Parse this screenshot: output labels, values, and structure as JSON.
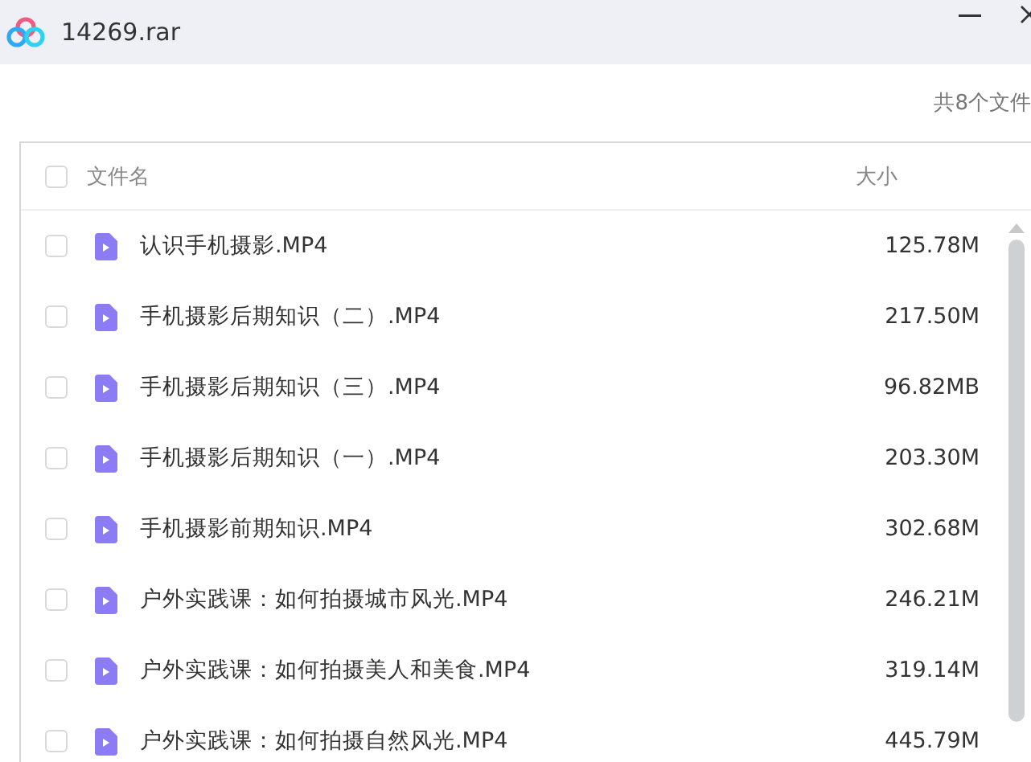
{
  "window": {
    "title": "14269.rar"
  },
  "summary": "共8个文件",
  "table": {
    "columns": [
      "文件名",
      "大小"
    ],
    "header_checked": false,
    "rows": [
      {
        "name": "认识手机摄影.MP4",
        "size": "125.78M",
        "checked": false
      },
      {
        "name": "手机摄影后期知识（二）.MP4",
        "size": "217.50M",
        "checked": false
      },
      {
        "name": "手机摄影后期知识（三）.MP4",
        "size": "96.82MB",
        "checked": false
      },
      {
        "name": "手机摄影后期知识（一）.MP4",
        "size": "203.30M",
        "checked": false
      },
      {
        "name": "手机摄影前期知识.MP4",
        "size": "302.68M",
        "checked": false
      },
      {
        "name": "户外实践课：如何拍摄城市风光.MP4",
        "size": "246.21M",
        "checked": false
      },
      {
        "name": "户外实践课：如何拍摄美人和美食.MP4",
        "size": "319.14M",
        "checked": false
      },
      {
        "name": "户外实践课：如何拍摄自然风光.MP4",
        "size": "445.79M",
        "checked": false
      }
    ]
  }
}
